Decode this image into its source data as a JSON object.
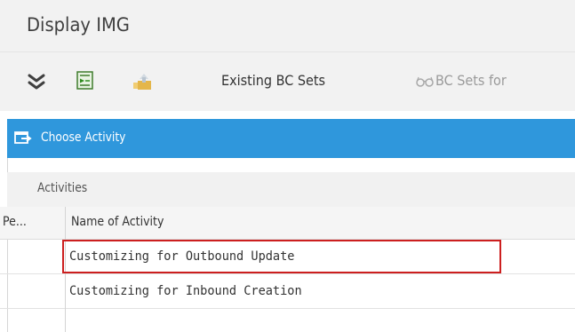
{
  "window": {
    "title": "Display IMG"
  },
  "toolbar": {
    "expand_icon": "double-chevron-down-icon",
    "execute_icon": "execute-icon",
    "folder_icon": "folder-icon",
    "existing_bc_sets_label": "Existing BC Sets",
    "bc_sets_for_label": "BC Sets for",
    "glasses_icon": "glasses-icon"
  },
  "panel": {
    "header_icon": "choose-activity-icon",
    "header_title": "Choose Activity",
    "tab_label": "Activities",
    "accent_color": "#2f97dc"
  },
  "table": {
    "columns": [
      "Pe...",
      "Name of Activity"
    ],
    "rows": [
      {
        "name": "Customizing for Outbound Update",
        "highlighted": true
      },
      {
        "name": "Customizing for Inbound Creation",
        "highlighted": false
      }
    ]
  }
}
